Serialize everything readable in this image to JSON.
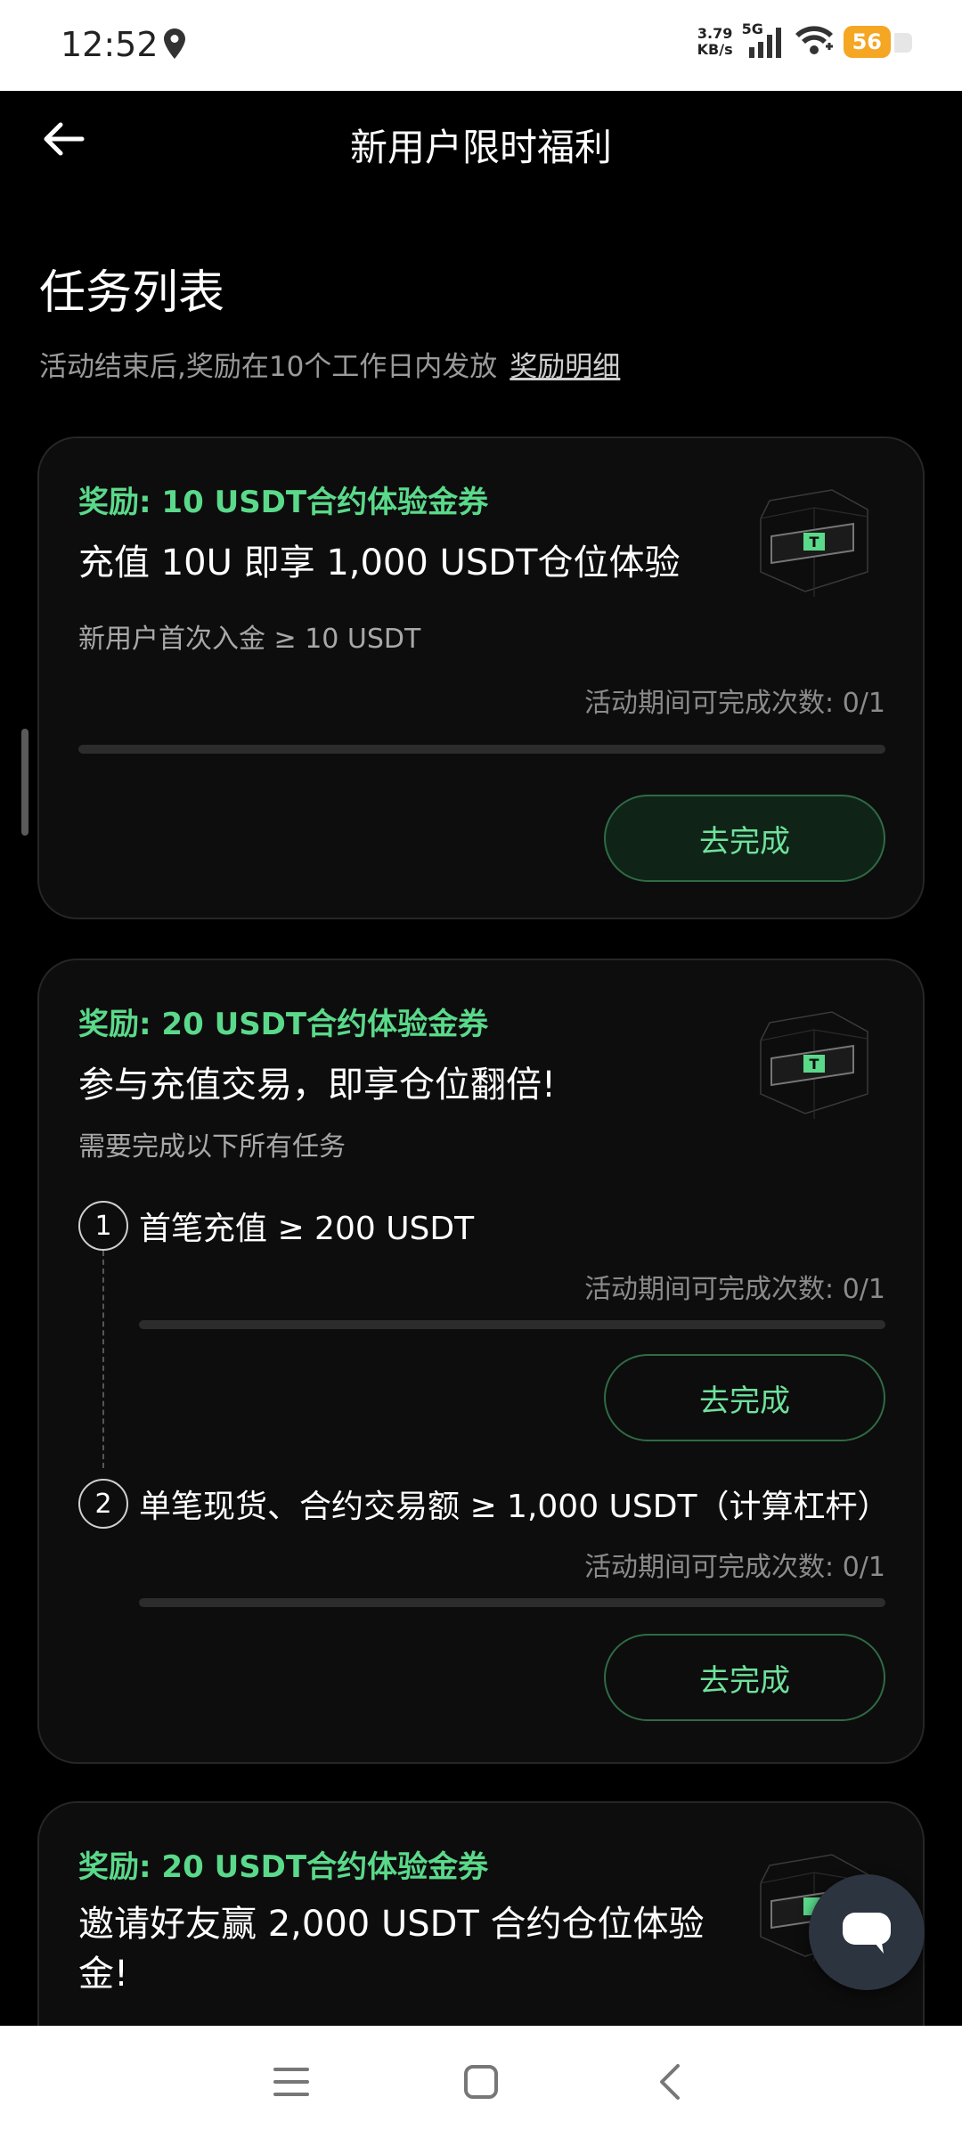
{
  "status_bar": {
    "time": "12:52",
    "net_speed_value": "3.79",
    "net_speed_unit": "KB/s",
    "network": "5G",
    "battery": "56"
  },
  "header": {
    "title": "新用户限时福利"
  },
  "section": {
    "title": "任务列表",
    "subtitle": "活动结束后,奖励在10个工作日内发放",
    "detail_link": "奖励明细"
  },
  "tasks": [
    {
      "reward": "奖励: 10 USDT合约体验金券",
      "title": "充值 10U 即享 1,000 USDT仓位体验",
      "desc": "新用户首次入金 ≥ 10 USDT",
      "count": "活动期间可完成次数: 0/1",
      "progress": 0,
      "button": "去完成"
    },
    {
      "reward": "奖励: 20 USDT合约体验金券",
      "title": "参与充值交易，即享仓位翻倍!",
      "desc": "需要完成以下所有任务",
      "steps": [
        {
          "num": "1",
          "text": "首笔充值 ≥ 200 USDT",
          "count": "活动期间可完成次数: 0/1",
          "progress": 0,
          "button": "去完成"
        },
        {
          "num": "2",
          "text": "单笔现货、合约交易额 ≥ 1,000 USDT（计算杠杆）",
          "count": "活动期间可完成次数: 0/1",
          "progress": 0,
          "button": "去完成"
        }
      ]
    },
    {
      "reward": "奖励: 20 USDT合约体验金券",
      "title": "邀请好友赢 2,000 USDT 合约仓位体验金!"
    }
  ],
  "colors": {
    "accent_green": "#5ad98a",
    "background": "#000000",
    "card_bg": "#0d0d0d",
    "battery": "#f5a623"
  },
  "icons": {
    "back": "arrow-left-icon",
    "location": "location-pin-icon",
    "chat": "chat-bubble-icon",
    "nav_menu": "menu-icon",
    "nav_home": "home-square-icon",
    "nav_back": "chevron-left-icon"
  }
}
